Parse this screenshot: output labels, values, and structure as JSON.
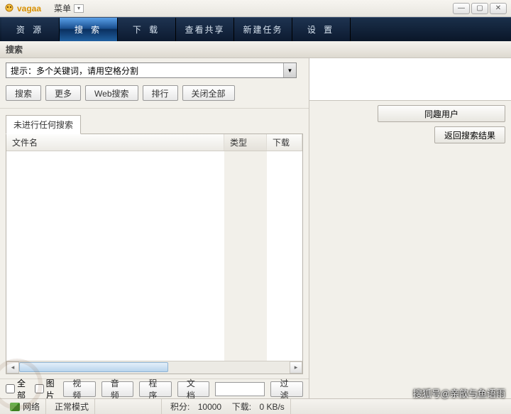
{
  "titlebar": {
    "app_name": "vagaa",
    "menu_label": "菜单"
  },
  "nav": {
    "tabs": [
      {
        "label": "资 源"
      },
      {
        "label": "搜 索"
      },
      {
        "label": "下 载"
      },
      {
        "label": "查看共享"
      },
      {
        "label": "新建任务"
      },
      {
        "label": "设 置"
      }
    ],
    "active_index": 1
  },
  "section": {
    "title": "搜索"
  },
  "search": {
    "placeholder": "提示：多个关键词，请用空格分割",
    "buttons": {
      "search": "搜索",
      "more": "更多",
      "web": "Web搜索",
      "rank": "排行",
      "close_all": "关闭全部"
    }
  },
  "results": {
    "tab_label": "未进行任何搜索",
    "columns": {
      "filename": "文件名",
      "type": "类型",
      "download": "下载"
    }
  },
  "filters": {
    "all": "全部",
    "image": "图片",
    "video": "视频",
    "audio": "音频",
    "program": "程序",
    "doc": "文档",
    "filter_btn": "过滤"
  },
  "sidebar": {
    "same_interest": "同趣用户",
    "back_to_results": "返回搜索结果"
  },
  "status": {
    "network": "网络",
    "mode": "正常模式",
    "points_label": "积分:",
    "points_value": "10000",
    "download_label": "下载:",
    "download_value": "0 KB/s"
  },
  "watermark": "搜狐号@亲歆与鱼语雨"
}
